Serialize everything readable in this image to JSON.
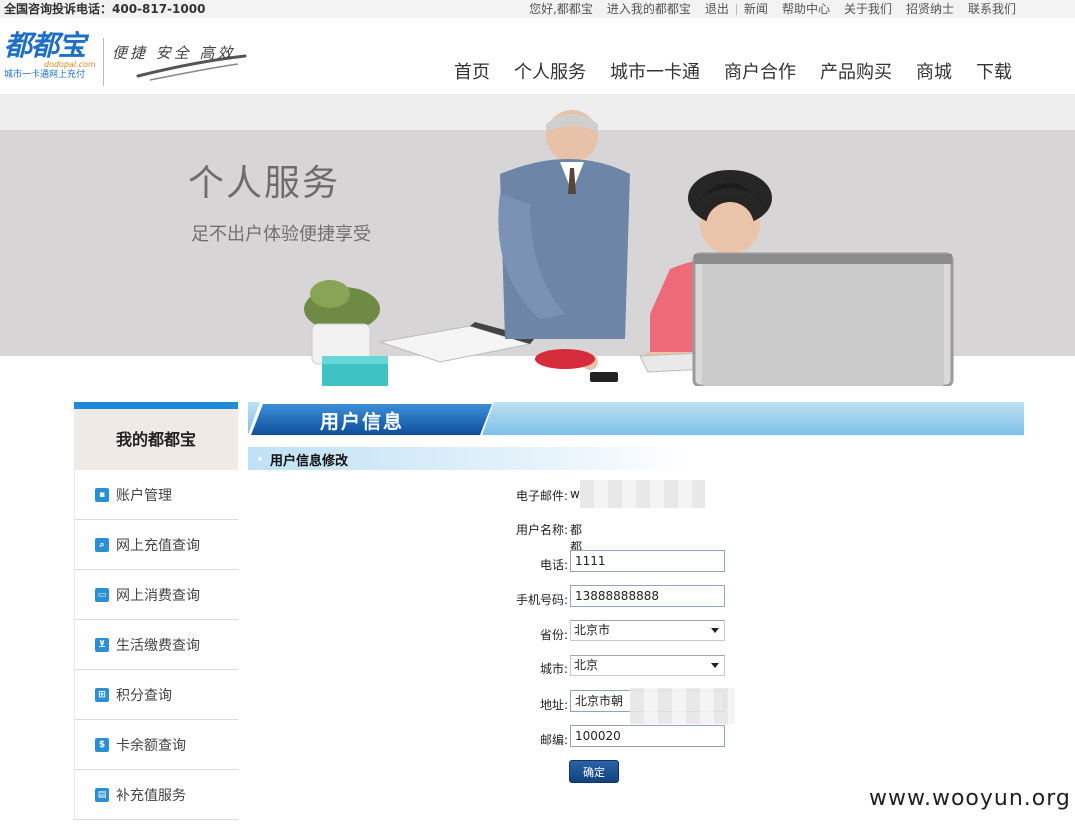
{
  "topbar": {
    "hotline": "全国咨询投诉电话：400-817-1000",
    "greeting": "您好,都都宝",
    "enter": "进入我的都都宝",
    "logout": "退出",
    "links": [
      "新闻",
      "帮助中心",
      "关于我们",
      "招贤纳士",
      "联系我们"
    ]
  },
  "header": {
    "logo_name": "都都宝",
    "logo_domain": "dodopal.com",
    "logo_tagline": "城市一卡通网上充付",
    "slogan": "便捷 安全 高效",
    "nav": [
      "首页",
      "个人服务",
      "城市一卡通",
      "商户合作",
      "产品购买",
      "商城",
      "下载"
    ]
  },
  "banner": {
    "title": "个人服务",
    "subtitle": "足不出户体验便捷享受"
  },
  "sidebar": {
    "title": "我的都都宝",
    "items": [
      {
        "label": "账户管理",
        "icon": "account-icon"
      },
      {
        "label": "网上充值查询",
        "icon": "search-icon"
      },
      {
        "label": "网上消费查询",
        "icon": "monitor-icon"
      },
      {
        "label": "生活缴费查询",
        "icon": "cart-icon"
      },
      {
        "label": "积分查询",
        "icon": "gift-icon"
      },
      {
        "label": "卡余额查询",
        "icon": "dollar-icon"
      },
      {
        "label": "补充值服务",
        "icon": "document-icon"
      }
    ]
  },
  "main": {
    "title": "用户信息",
    "section": "用户信息修改",
    "form": {
      "email_label": "电子邮件:",
      "email_value": "w",
      "username_label": "用户名称:",
      "username_value": "都都宝",
      "phone_label": "电话:",
      "phone_value": "1111",
      "mobile_label": "手机号码:",
      "mobile_value": "13888888888",
      "province_label": "省份:",
      "province_value": "北京市",
      "city_label": "城市:",
      "city_value": "北京",
      "address_label": "地址:",
      "address_value": "北京市朝",
      "zip_label": "邮编:",
      "zip_value": "100020",
      "submit_label": "确定"
    }
  },
  "watermark": "www.wooyun.org"
}
